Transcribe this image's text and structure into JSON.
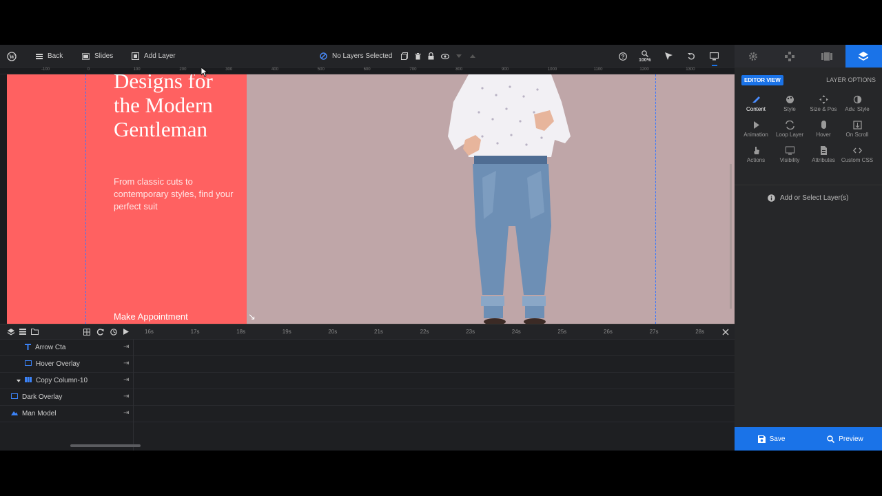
{
  "toolbar": {
    "back_label": "Back",
    "slides_label": "Slides",
    "add_layer_label": "Add Layer",
    "selection_status": "No Layers Selected",
    "zoom_label": "100%"
  },
  "ruler_ticks": [
    "-100",
    "0",
    "100",
    "200",
    "300",
    "400",
    "500",
    "600",
    "700",
    "800",
    "900",
    "1000",
    "1100",
    "1200",
    "1300"
  ],
  "slide": {
    "headline_line1": "Designs for",
    "headline_line2": "the Modern",
    "headline_line3": "Gentleman",
    "subtext": "From classic cuts to contemporary styles, find your perfect suit",
    "cta_label": "Make Appointment",
    "cta_arrow": "↘"
  },
  "timeline": {
    "ticks": [
      "16s",
      "17s",
      "18s",
      "19s",
      "20s",
      "21s",
      "22s",
      "23s",
      "24s",
      "25s",
      "26s",
      "27s",
      "28s"
    ],
    "layers": [
      {
        "name": "Arrow Cta",
        "icon": "text-icon"
      },
      {
        "name": "Hover Overlay",
        "icon": "shape-icon"
      },
      {
        "name": "Copy Column-10",
        "icon": "column-icon"
      },
      {
        "name": "Dark Overlay",
        "icon": "shape-icon"
      },
      {
        "name": "Man Model",
        "icon": "image-icon"
      }
    ]
  },
  "panel": {
    "editor_view": "EDITOR VIEW",
    "layer_options": "LAYER OPTIONS",
    "options": [
      "Content",
      "Style",
      "Size & Pos",
      "Adv. Style",
      "Animation",
      "Loop Layer",
      "Hover",
      "On Scroll",
      "Actions",
      "Visibility",
      "Attributes",
      "Custom CSS"
    ],
    "hint": "Add or Select Layer(s)",
    "save_label": "Save",
    "preview_label": "Preview"
  },
  "colors": {
    "accent": "#1a73e8",
    "slide_red": "#ff6161",
    "slide_bg": "#bfa6a8"
  }
}
